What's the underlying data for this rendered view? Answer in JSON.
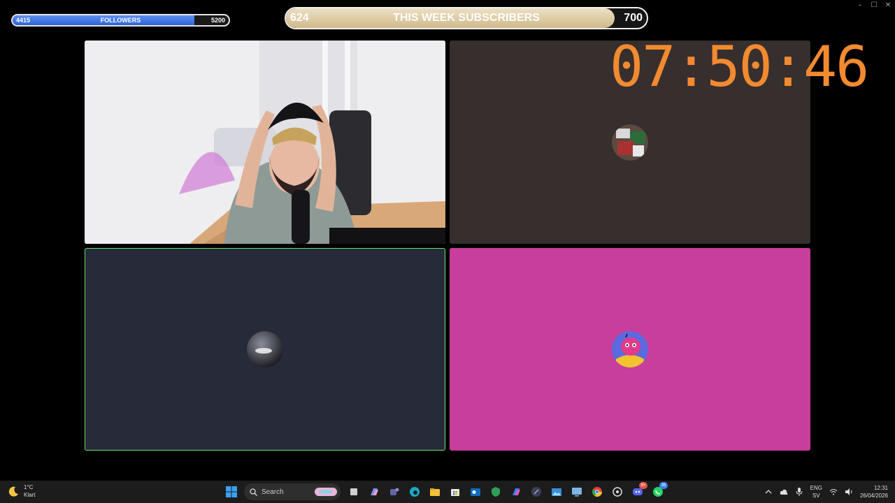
{
  "followers": {
    "current": "4415",
    "label": "FOLLOWERS",
    "goal": "5200",
    "progress": 0.84,
    "fill_color": "#3a6fe0"
  },
  "subscribers": {
    "current": "624",
    "label": "THIS WEEK SUBSCRIBERS",
    "goal": "700",
    "progress": 0.91,
    "fill_color": "#d8c59c"
  },
  "timer": {
    "value": "07:50:46",
    "color": "#f28a30"
  },
  "tiles": [
    {
      "name": "camera",
      "background": "#f0f0f2"
    },
    {
      "name": "participant-2",
      "background": "#372e2e"
    },
    {
      "name": "participant-3",
      "background": "#272a38",
      "speaking_border": "#67e56a"
    },
    {
      "name": "participant-4",
      "background": "#c73e9c"
    }
  ],
  "taskbar": {
    "weather": {
      "temp": "1°C",
      "condition": "Klart",
      "icon": "moon-icon"
    },
    "search_label": "Search",
    "apps": [
      "windows-start-icon",
      "search-icon",
      "copilot-art-icon",
      "file-icon",
      "copilot-icon",
      "teams-icon",
      "edge-icon",
      "file-explorer-icon",
      "microsoft-store-icon",
      "outlook-icon",
      "vpn-icon",
      "m365-icon",
      "app-icon",
      "photos-icon",
      "remote-desktop-icon",
      "chrome-icon",
      "chatgpt-icon",
      "discord-icon",
      "whatsapp-icon"
    ],
    "discord_badge": "9+",
    "whatsapp_badge": "36",
    "tray": {
      "lang": "ENG",
      "layout": "SV",
      "time": "12:31",
      "date": "26/04/2026"
    }
  }
}
